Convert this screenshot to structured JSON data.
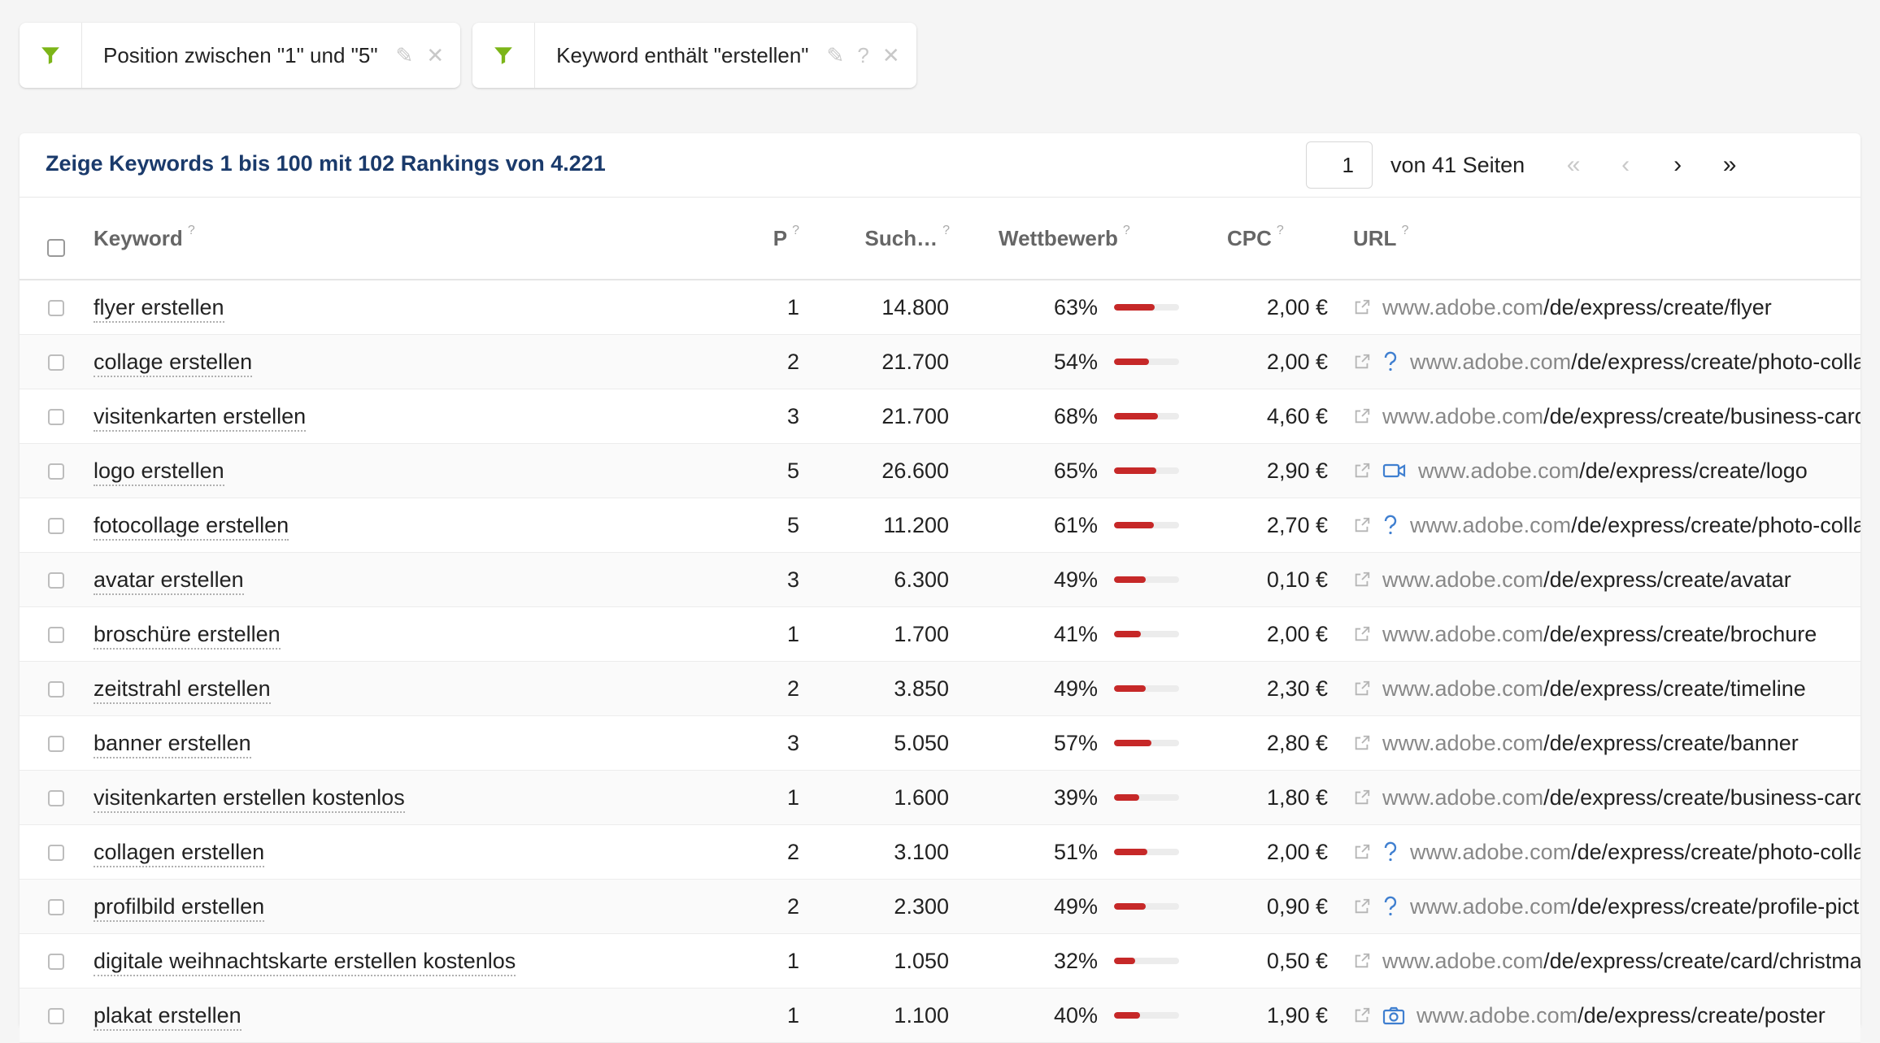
{
  "colors": {
    "accent": "#7cb518",
    "title": "#1a3a6b",
    "bar": "#c62828",
    "link_icon": "#b5b5b5",
    "feature_icon": "#3f7fd0"
  },
  "filters": [
    {
      "icon": "filter-icon",
      "text": "Position zwischen \"1\" und \"5\"",
      "actions": [
        "pencil-icon",
        "close-icon"
      ]
    },
    {
      "icon": "filter-icon",
      "text": "Keyword enthält \"erstellen\"",
      "actions": [
        "pencil-icon",
        "help-icon",
        "close-icon"
      ]
    }
  ],
  "summary": "Zeige Keywords 1 bis 100 mit 102 Rankings von 4.221",
  "pager": {
    "current": "1",
    "of_text": "von 41 Seiten",
    "first": "«",
    "prev": "‹",
    "next": "›",
    "last": "»"
  },
  "columns": {
    "keyword": "Keyword",
    "position": "P",
    "volume": "Such…",
    "competition": "Wettbewerb",
    "cpc": "CPC",
    "url": "URL",
    "help": "?"
  },
  "rows": [
    {
      "keyword": "flyer erstellen",
      "position": "1",
      "volume": "14.800",
      "competition": "63%",
      "comp_value": 63,
      "cpc": "2,00 €",
      "feature": "",
      "domain": "www.adobe.com",
      "path": "/de/express/create/flyer"
    },
    {
      "keyword": "collage erstellen",
      "position": "2",
      "volume": "21.700",
      "competition": "54%",
      "comp_value": 54,
      "cpc": "2,00 €",
      "feature": "faq-icon",
      "domain": "www.adobe.com",
      "path": "/de/express/create/photo-collage"
    },
    {
      "keyword": "visitenkarten erstellen",
      "position": "3",
      "volume": "21.700",
      "competition": "68%",
      "comp_value": 68,
      "cpc": "4,60 €",
      "feature": "",
      "domain": "www.adobe.com",
      "path": "/de/express/create/business-card"
    },
    {
      "keyword": "logo erstellen",
      "position": "5",
      "volume": "26.600",
      "competition": "65%",
      "comp_value": 65,
      "cpc": "2,90 €",
      "feature": "video-icon",
      "domain": "www.adobe.com",
      "path": "/de/express/create/logo"
    },
    {
      "keyword": "fotocollage erstellen",
      "position": "5",
      "volume": "11.200",
      "competition": "61%",
      "comp_value": 61,
      "cpc": "2,70 €",
      "feature": "faq-icon",
      "domain": "www.adobe.com",
      "path": "/de/express/create/photo-collage"
    },
    {
      "keyword": "avatar erstellen",
      "position": "3",
      "volume": "6.300",
      "competition": "49%",
      "comp_value": 49,
      "cpc": "0,10 €",
      "feature": "",
      "domain": "www.adobe.com",
      "path": "/de/express/create/avatar"
    },
    {
      "keyword": "broschüre erstellen",
      "position": "1",
      "volume": "1.700",
      "competition": "41%",
      "comp_value": 41,
      "cpc": "2,00 €",
      "feature": "",
      "domain": "www.adobe.com",
      "path": "/de/express/create/brochure"
    },
    {
      "keyword": "zeitstrahl erstellen",
      "position": "2",
      "volume": "3.850",
      "competition": "49%",
      "comp_value": 49,
      "cpc": "2,30 €",
      "feature": "",
      "domain": "www.adobe.com",
      "path": "/de/express/create/timeline"
    },
    {
      "keyword": "banner erstellen",
      "position": "3",
      "volume": "5.050",
      "competition": "57%",
      "comp_value": 57,
      "cpc": "2,80 €",
      "feature": "",
      "domain": "www.adobe.com",
      "path": "/de/express/create/banner"
    },
    {
      "keyword": "visitenkarten erstellen kostenlos",
      "position": "1",
      "volume": "1.600",
      "competition": "39%",
      "comp_value": 39,
      "cpc": "1,80 €",
      "feature": "",
      "domain": "www.adobe.com",
      "path": "/de/express/create/business-card"
    },
    {
      "keyword": "collagen erstellen",
      "position": "2",
      "volume": "3.100",
      "competition": "51%",
      "comp_value": 51,
      "cpc": "2,00 €",
      "feature": "faq-icon",
      "domain": "www.adobe.com",
      "path": "/de/express/create/photo-collage"
    },
    {
      "keyword": "profilbild erstellen",
      "position": "2",
      "volume": "2.300",
      "competition": "49%",
      "comp_value": 49,
      "cpc": "0,90 €",
      "feature": "faq-icon",
      "domain": "www.adobe.com",
      "path": "/de/express/create/profile-picture"
    },
    {
      "keyword": "digitale weihnachtskarte erstellen kostenlos",
      "position": "1",
      "volume": "1.050",
      "competition": "32%",
      "comp_value": 32,
      "cpc": "0,50 €",
      "feature": "",
      "domain": "www.adobe.com",
      "path": "/de/express/create/card/christmas"
    },
    {
      "keyword": "plakat erstellen",
      "position": "1",
      "volume": "1.100",
      "competition": "40%",
      "comp_value": 40,
      "cpc": "1,90 €",
      "feature": "image-icon",
      "domain": "www.adobe.com",
      "path": "/de/express/create/poster"
    }
  ]
}
